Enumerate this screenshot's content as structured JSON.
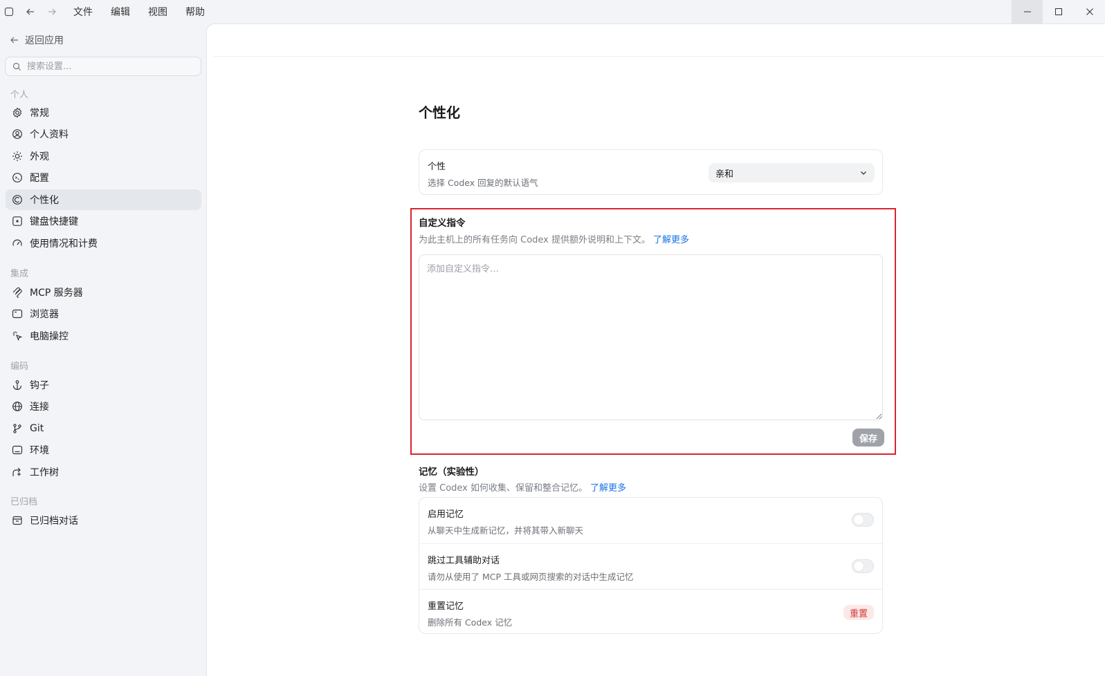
{
  "menu": [
    "文件",
    "编辑",
    "视图",
    "帮助"
  ],
  "sidebar": {
    "back_label": "返回应用",
    "search_placeholder": "搜索设置...",
    "sections": {
      "personal": "个人",
      "integration": "集成",
      "coding": "编码",
      "archived": "已归档"
    },
    "items": {
      "general": "常规",
      "profile": "个人资料",
      "appearance": "外观",
      "config": "配置",
      "personalization": "个性化",
      "shortcuts": "键盘快捷键",
      "usage": "使用情况和计费",
      "mcp": "MCP 服务器",
      "browser": "浏览器",
      "computer_control": "电脑操控",
      "hooks": "钩子",
      "connections": "连接",
      "git": "Git",
      "environment": "环境",
      "worktree": "工作树",
      "archived_chats": "已归档对话"
    },
    "active": "personalization"
  },
  "main": {
    "title": "个性化",
    "personality": {
      "title": "个性",
      "subtitle": "选择 Codex 回复的默认语气",
      "value": "亲和"
    },
    "custom_instructions": {
      "title": "自定义指令",
      "subtitle": "为此主机上的所有任务向 Codex 提供额外说明和上下文。",
      "learn_more": "了解更多",
      "placeholder": "添加自定义指令…",
      "save_label": "保存"
    },
    "memory": {
      "title": "记忆（实验性）",
      "subtitle": "设置 Codex 如何收集、保留和整合记忆。",
      "learn_more": "了解更多",
      "rows": [
        {
          "title": "启用记忆",
          "subtitle": "从聊天中生成新记忆，并将其带入新聊天",
          "enabled": false
        },
        {
          "title": "跳过工具辅助对话",
          "subtitle": "请勿从使用了 MCP 工具或网页搜索的对话中生成记忆",
          "enabled": false
        },
        {
          "title": "重置记忆",
          "subtitle": "删除所有 Codex 记忆",
          "action_label": "重置"
        }
      ]
    }
  },
  "colors": {
    "highlight_border": "#d9232c",
    "link": "#1a73e8",
    "reset_text": "#d33a3a"
  }
}
